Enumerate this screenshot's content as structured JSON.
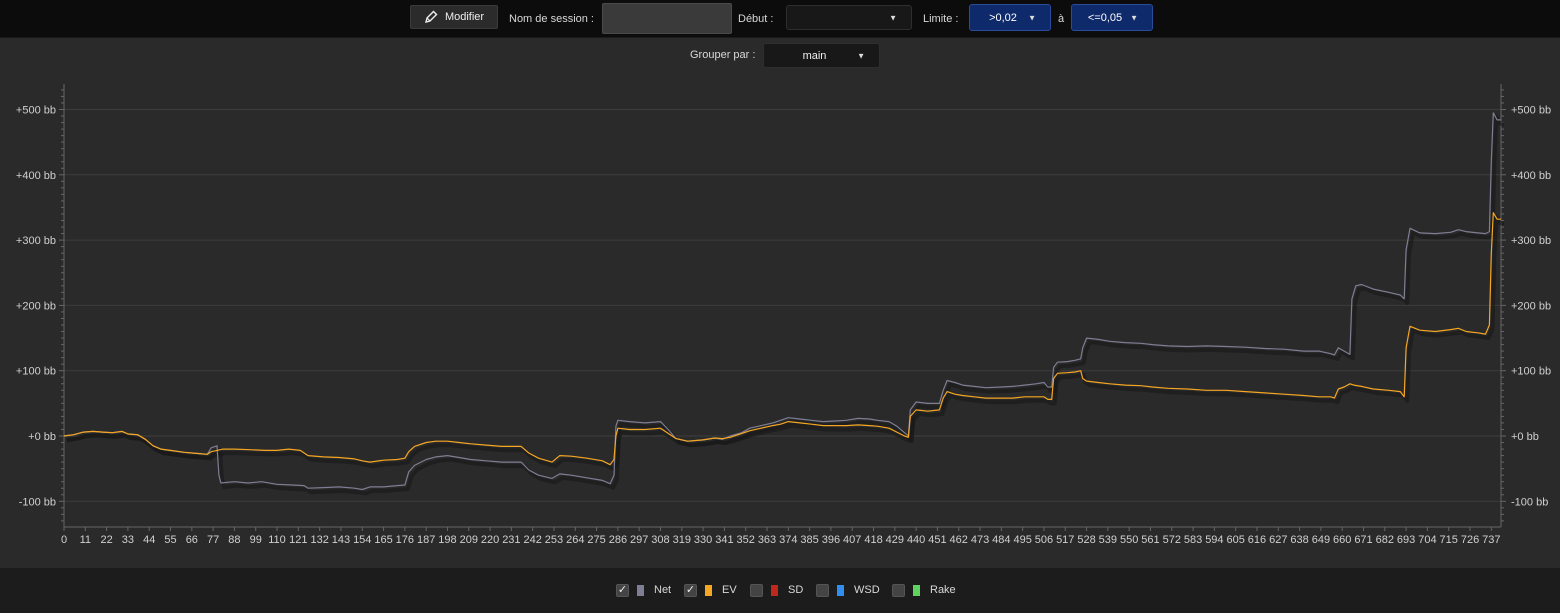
{
  "toolbar": {
    "modifier_label": "Modifier",
    "session_label": "Nom de session :",
    "session_value": "",
    "debut_label": "Début :",
    "debut_value": "",
    "limite_label": "Limite :",
    "limite_from": ">0,02",
    "a_label": "à",
    "limite_to": "<=0,05"
  },
  "group": {
    "label": "Grouper par :",
    "value": "main"
  },
  "legend": [
    {
      "label": "Net",
      "checked": true,
      "color": "#7e7e94"
    },
    {
      "label": "EV",
      "checked": true,
      "color": "#f5a623"
    },
    {
      "label": "SD",
      "checked": false,
      "color": "#c0281e"
    },
    {
      "label": "WSD",
      "checked": false,
      "color": "#2f8ef0"
    },
    {
      "label": "Rake",
      "checked": false,
      "color": "#5fd35f"
    }
  ],
  "chart_data": {
    "type": "line",
    "x_ticks": [
      0,
      11,
      22,
      33,
      44,
      55,
      66,
      77,
      88,
      99,
      110,
      121,
      132,
      143,
      154,
      165,
      176,
      187,
      198,
      209,
      220,
      231,
      242,
      253,
      264,
      275,
      286,
      297,
      308,
      319,
      330,
      341,
      352,
      363,
      374,
      385,
      396,
      407,
      418,
      429,
      440,
      451,
      462,
      473,
      484,
      495,
      506,
      517,
      528,
      539,
      550,
      561,
      572,
      583,
      594,
      605,
      616,
      627,
      638,
      649,
      660,
      671,
      682,
      693,
      704,
      715,
      726,
      737
    ],
    "y_tick_labels": [
      "+500 bb",
      "+400 bb",
      "+300 bb",
      "+200 bb",
      "+100 bb",
      "+0 bb",
      "-100 bb"
    ],
    "y_ticks": [
      500,
      400,
      300,
      200,
      100,
      0,
      -100
    ],
    "xlim": [
      0,
      742
    ],
    "ylim": [
      -140,
      540
    ],
    "grid": true,
    "series": [
      {
        "name": "Net",
        "color": "#7e7e94",
        "points": [
          [
            0,
            0
          ],
          [
            5,
            2
          ],
          [
            10,
            6
          ],
          [
            15,
            7
          ],
          [
            20,
            6
          ],
          [
            25,
            5
          ],
          [
            30,
            7
          ],
          [
            33,
            3
          ],
          [
            38,
            2
          ],
          [
            42,
            -5
          ],
          [
            46,
            -15
          ],
          [
            50,
            -20
          ],
          [
            55,
            -22
          ],
          [
            62,
            -25
          ],
          [
            70,
            -27
          ],
          [
            74,
            -28
          ],
          [
            76,
            -18
          ],
          [
            79,
            -15
          ],
          [
            80,
            -60
          ],
          [
            81,
            -72
          ],
          [
            88,
            -70
          ],
          [
            95,
            -72
          ],
          [
            102,
            -70
          ],
          [
            110,
            -74
          ],
          [
            118,
            -75
          ],
          [
            124,
            -76
          ],
          [
            126,
            -80
          ],
          [
            134,
            -79
          ],
          [
            142,
            -78
          ],
          [
            150,
            -80
          ],
          [
            154,
            -82
          ],
          [
            158,
            -78
          ],
          [
            165,
            -78
          ],
          [
            172,
            -76
          ],
          [
            176,
            -75
          ],
          [
            178,
            -55
          ],
          [
            181,
            -45
          ],
          [
            187,
            -36
          ],
          [
            192,
            -32
          ],
          [
            198,
            -30
          ],
          [
            204,
            -33
          ],
          [
            210,
            -36
          ],
          [
            218,
            -38
          ],
          [
            226,
            -40
          ],
          [
            236,
            -40
          ],
          [
            240,
            -52
          ],
          [
            245,
            -60
          ],
          [
            252,
            -65
          ],
          [
            256,
            -58
          ],
          [
            262,
            -60
          ],
          [
            270,
            -64
          ],
          [
            278,
            -68
          ],
          [
            282,
            -73
          ],
          [
            284,
            -60
          ],
          [
            285,
            15
          ],
          [
            286,
            24
          ],
          [
            292,
            22
          ],
          [
            300,
            20
          ],
          [
            308,
            22
          ],
          [
            312,
            10
          ],
          [
            316,
            -4
          ],
          [
            322,
            -8
          ],
          [
            330,
            -6
          ],
          [
            336,
            -3
          ],
          [
            340,
            -5
          ],
          [
            344,
            0
          ],
          [
            350,
            5
          ],
          [
            354,
            12
          ],
          [
            360,
            16
          ],
          [
            366,
            20
          ],
          [
            370,
            24
          ],
          [
            374,
            28
          ],
          [
            380,
            26
          ],
          [
            386,
            24
          ],
          [
            392,
            22
          ],
          [
            398,
            23
          ],
          [
            404,
            24
          ],
          [
            410,
            27
          ],
          [
            416,
            26
          ],
          [
            420,
            24
          ],
          [
            426,
            22
          ],
          [
            430,
            15
          ],
          [
            434,
            5
          ],
          [
            436,
            0
          ],
          [
            437,
            40
          ],
          [
            440,
            52
          ],
          [
            446,
            50
          ],
          [
            452,
            50
          ],
          [
            454,
            70
          ],
          [
            456,
            85
          ],
          [
            460,
            82
          ],
          [
            464,
            78
          ],
          [
            470,
            76
          ],
          [
            476,
            74
          ],
          [
            484,
            75
          ],
          [
            490,
            76
          ],
          [
            496,
            78
          ],
          [
            502,
            80
          ],
          [
            506,
            82
          ],
          [
            508,
            75
          ],
          [
            510,
            75
          ],
          [
            511,
            105
          ],
          [
            513,
            113
          ],
          [
            518,
            114
          ],
          [
            522,
            116
          ],
          [
            525,
            118
          ],
          [
            526,
            135
          ],
          [
            528,
            150
          ],
          [
            534,
            148
          ],
          [
            540,
            145
          ],
          [
            548,
            143
          ],
          [
            556,
            142
          ],
          [
            562,
            140
          ],
          [
            570,
            138
          ],
          [
            580,
            137
          ],
          [
            590,
            138
          ],
          [
            600,
            137
          ],
          [
            610,
            136
          ],
          [
            620,
            134
          ],
          [
            630,
            133
          ],
          [
            640,
            130
          ],
          [
            648,
            130
          ],
          [
            654,
            126
          ],
          [
            656,
            124
          ],
          [
            658,
            135
          ],
          [
            661,
            130
          ],
          [
            664,
            125
          ],
          [
            665,
            210
          ],
          [
            667,
            230
          ],
          [
            670,
            232
          ],
          [
            676,
            225
          ],
          [
            684,
            220
          ],
          [
            690,
            216
          ],
          [
            692,
            210
          ],
          [
            693,
            285
          ],
          [
            695,
            318
          ],
          [
            700,
            311
          ],
          [
            708,
            310
          ],
          [
            716,
            312
          ],
          [
            720,
            316
          ],
          [
            724,
            313
          ],
          [
            730,
            311
          ],
          [
            734,
            310
          ],
          [
            736,
            313
          ],
          [
            737,
            420
          ],
          [
            738,
            495
          ],
          [
            740,
            484
          ],
          [
            742,
            484
          ]
        ]
      },
      {
        "name": "EV",
        "color": "#f5a623",
        "points": [
          [
            0,
            0
          ],
          [
            5,
            2
          ],
          [
            10,
            6
          ],
          [
            15,
            7
          ],
          [
            20,
            6
          ],
          [
            25,
            5
          ],
          [
            30,
            7
          ],
          [
            33,
            3
          ],
          [
            38,
            2
          ],
          [
            42,
            -5
          ],
          [
            46,
            -15
          ],
          [
            50,
            -20
          ],
          [
            55,
            -22
          ],
          [
            62,
            -25
          ],
          [
            70,
            -27
          ],
          [
            74,
            -28
          ],
          [
            76,
            -24
          ],
          [
            79,
            -22
          ],
          [
            82,
            -20
          ],
          [
            88,
            -20
          ],
          [
            96,
            -21
          ],
          [
            104,
            -22
          ],
          [
            110,
            -22
          ],
          [
            116,
            -20
          ],
          [
            122,
            -22
          ],
          [
            126,
            -30
          ],
          [
            134,
            -32
          ],
          [
            142,
            -33
          ],
          [
            150,
            -35
          ],
          [
            154,
            -38
          ],
          [
            158,
            -40
          ],
          [
            165,
            -37
          ],
          [
            172,
            -36
          ],
          [
            176,
            -34
          ],
          [
            178,
            -24
          ],
          [
            181,
            -16
          ],
          [
            187,
            -10
          ],
          [
            192,
            -8
          ],
          [
            198,
            -8
          ],
          [
            204,
            -10
          ],
          [
            210,
            -12
          ],
          [
            218,
            -14
          ],
          [
            226,
            -16
          ],
          [
            236,
            -16
          ],
          [
            240,
            -26
          ],
          [
            245,
            -34
          ],
          [
            252,
            -40
          ],
          [
            256,
            -30
          ],
          [
            262,
            -31
          ],
          [
            270,
            -34
          ],
          [
            278,
            -38
          ],
          [
            282,
            -44
          ],
          [
            284,
            -36
          ],
          [
            285,
            0
          ],
          [
            286,
            12
          ],
          [
            292,
            10
          ],
          [
            300,
            10
          ],
          [
            308,
            12
          ],
          [
            312,
            4
          ],
          [
            316,
            -4
          ],
          [
            322,
            -8
          ],
          [
            330,
            -6
          ],
          [
            336,
            -3
          ],
          [
            340,
            -4
          ],
          [
            344,
            -2
          ],
          [
            350,
            4
          ],
          [
            354,
            8
          ],
          [
            360,
            12
          ],
          [
            366,
            16
          ],
          [
            370,
            18
          ],
          [
            374,
            22
          ],
          [
            380,
            20
          ],
          [
            386,
            18
          ],
          [
            392,
            16
          ],
          [
            398,
            16
          ],
          [
            404,
            16
          ],
          [
            410,
            17
          ],
          [
            416,
            16
          ],
          [
            420,
            15
          ],
          [
            426,
            12
          ],
          [
            430,
            6
          ],
          [
            434,
            0
          ],
          [
            436,
            -2
          ],
          [
            437,
            30
          ],
          [
            440,
            40
          ],
          [
            446,
            38
          ],
          [
            452,
            40
          ],
          [
            454,
            58
          ],
          [
            456,
            68
          ],
          [
            460,
            64
          ],
          [
            464,
            62
          ],
          [
            470,
            60
          ],
          [
            476,
            58
          ],
          [
            484,
            58
          ],
          [
            490,
            58
          ],
          [
            496,
            60
          ],
          [
            502,
            60
          ],
          [
            506,
            60
          ],
          [
            508,
            56
          ],
          [
            510,
            56
          ],
          [
            511,
            88
          ],
          [
            513,
            96
          ],
          [
            518,
            97
          ],
          [
            522,
            98
          ],
          [
            525,
            100
          ],
          [
            526,
            88
          ],
          [
            528,
            84
          ],
          [
            534,
            82
          ],
          [
            540,
            80
          ],
          [
            548,
            78
          ],
          [
            556,
            77
          ],
          [
            562,
            75
          ],
          [
            570,
            73
          ],
          [
            580,
            72
          ],
          [
            590,
            70
          ],
          [
            600,
            70
          ],
          [
            610,
            68
          ],
          [
            620,
            66
          ],
          [
            630,
            64
          ],
          [
            640,
            62
          ],
          [
            648,
            60
          ],
          [
            654,
            60
          ],
          [
            656,
            58
          ],
          [
            658,
            72
          ],
          [
            661,
            75
          ],
          [
            664,
            80
          ],
          [
            666,
            78
          ],
          [
            670,
            76
          ],
          [
            676,
            72
          ],
          [
            684,
            70
          ],
          [
            690,
            68
          ],
          [
            692,
            60
          ],
          [
            693,
            135
          ],
          [
            695,
            168
          ],
          [
            700,
            162
          ],
          [
            708,
            160
          ],
          [
            716,
            163
          ],
          [
            720,
            165
          ],
          [
            724,
            160
          ],
          [
            730,
            158
          ],
          [
            734,
            156
          ],
          [
            736,
            170
          ],
          [
            737,
            280
          ],
          [
            738,
            342
          ],
          [
            740,
            332
          ],
          [
            742,
            332
          ]
        ]
      }
    ]
  }
}
